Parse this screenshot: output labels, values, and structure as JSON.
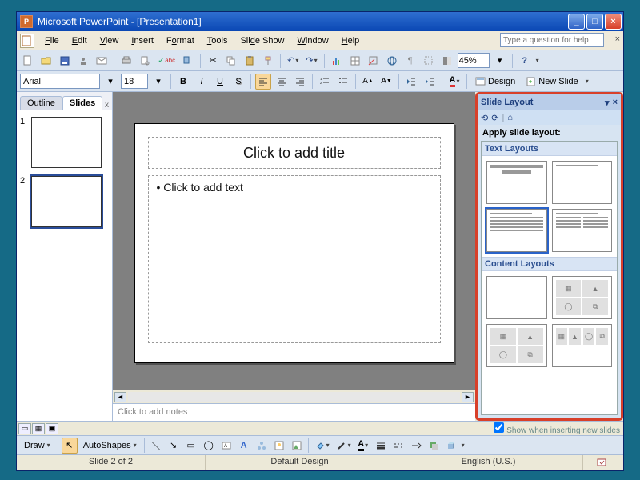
{
  "window": {
    "title": "Microsoft PowerPoint - [Presentation1]",
    "minimize": "_",
    "maximize": "□",
    "close": "×"
  },
  "menu": {
    "file": "File",
    "edit": "Edit",
    "view": "View",
    "insert": "Insert",
    "format": "Format",
    "tools": "Tools",
    "slideshow": "Slide Show",
    "window": "Window",
    "help": "Help",
    "ask_placeholder": "Type a question for help",
    "mdi_close": "×"
  },
  "toolbar1": {
    "zoom": "45%",
    "design_label": "Design",
    "newslide_label": "New Slide"
  },
  "toolbar2": {
    "font": "Arial",
    "size": "18",
    "bold": "B",
    "italic": "I",
    "underline": "U",
    "shadow": "S"
  },
  "leftpanel": {
    "tab_outline": "Outline",
    "tab_slides": "Slides",
    "close": "x",
    "slides": [
      {
        "num": "1"
      },
      {
        "num": "2"
      }
    ],
    "selected_index": 1
  },
  "slide": {
    "title_placeholder": "Click to add title",
    "body_placeholder": "Click to add text"
  },
  "notes": {
    "placeholder": "Click to add notes"
  },
  "taskpane": {
    "title": "Slide Layout",
    "dropdown": "▾",
    "close": "×",
    "back": "⟲",
    "fwd": "⟳",
    "home": "⌂",
    "apply_label": "Apply slide layout:",
    "section_text": "Text Layouts",
    "section_content": "Content Layouts",
    "show_option": "Show when inserting new slides"
  },
  "draw": {
    "draw_label": "Draw",
    "autoshapes_label": "AutoShapes"
  },
  "status": {
    "slide": "Slide 2 of 2",
    "design": "Default Design",
    "lang": "English (U.S.)"
  }
}
